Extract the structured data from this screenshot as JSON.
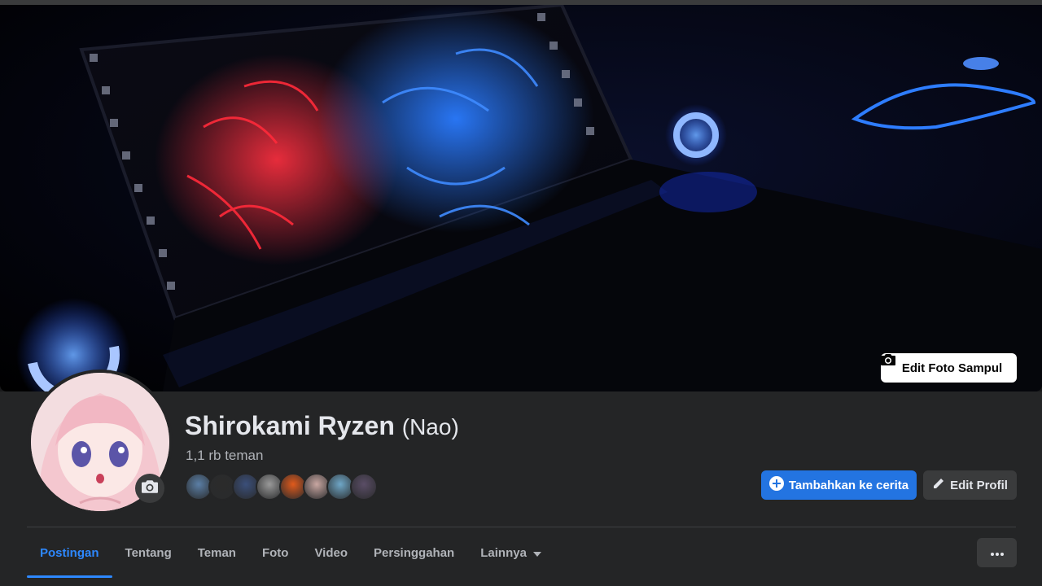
{
  "cover": {
    "edit_label": "Edit Foto Sampul"
  },
  "profile": {
    "name": "Shirokami Ryzen",
    "alternate_name": "(Nao)",
    "friends_count": "1,1 rb teman",
    "friend_avatar_colors": [
      "#5b7fa6",
      "#2b2b2b",
      "#3b4f7a",
      "#9a9a9a",
      "#e05a1c",
      "#c9a7a2",
      "#6fa7c7",
      "#5a4d66"
    ]
  },
  "actions": {
    "add_to_story": "Tambahkan ke cerita",
    "edit_profile": "Edit Profil"
  },
  "tabs": [
    {
      "label": "Postingan",
      "active": true
    },
    {
      "label": "Tentang",
      "active": false
    },
    {
      "label": "Teman",
      "active": false
    },
    {
      "label": "Foto",
      "active": false
    },
    {
      "label": "Video",
      "active": false
    },
    {
      "label": "Persinggahan",
      "active": false
    },
    {
      "label": "Lainnya",
      "active": false
    }
  ],
  "colors": {
    "background": "#18191a",
    "panel": "#242526",
    "accent": "#2d88ff",
    "primary_button": "#2374e1",
    "secondary_button": "#3a3b3c"
  }
}
